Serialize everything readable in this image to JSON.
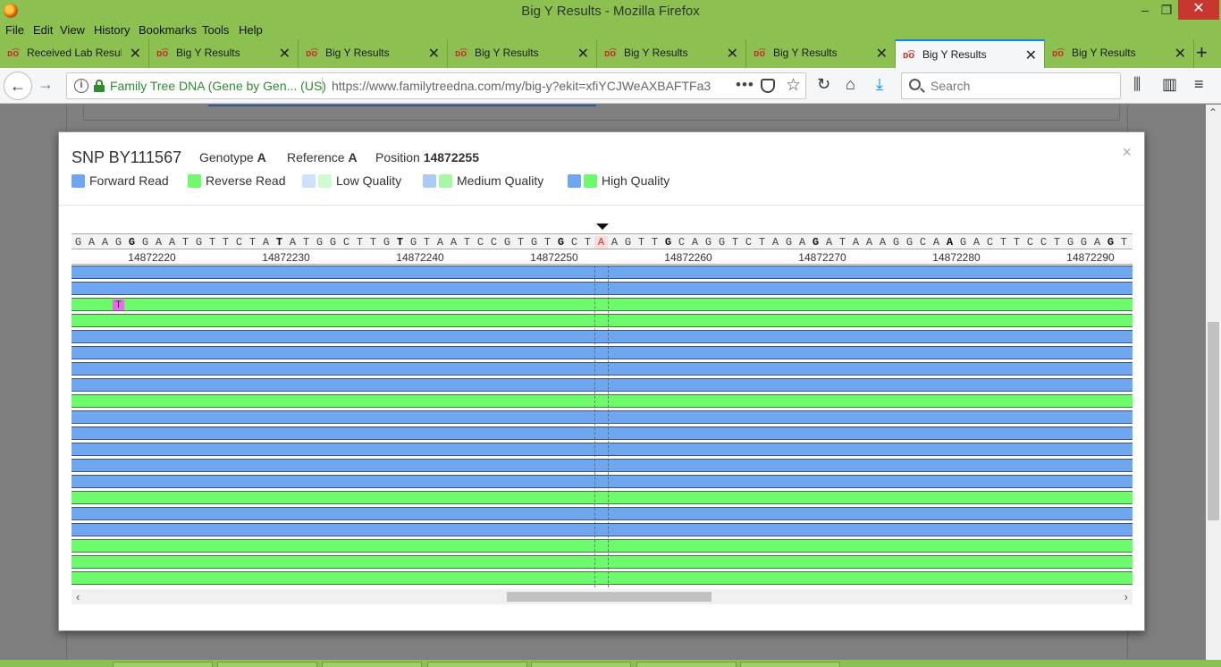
{
  "window": {
    "title": "Big Y Results - Mozilla Firefox",
    "min": "‒",
    "max": "❐",
    "close": "✕"
  },
  "menu": [
    "File",
    "Edit",
    "View",
    "History",
    "Bookmarks",
    "Tools",
    "Help"
  ],
  "tabs": [
    {
      "label": "Received Lab Results"
    },
    {
      "label": "Big Y Results"
    },
    {
      "label": "Big Y Results"
    },
    {
      "label": "Big Y Results"
    },
    {
      "label": "Big Y Results"
    },
    {
      "label": "Big Y Results"
    },
    {
      "label": "Big Y Results",
      "active": true
    },
    {
      "label": "Big Y Results"
    }
  ],
  "favicon_glyph": "ᴅ͡ᴏ",
  "nav": {
    "site_identity": "Family Tree DNA (Gene by Gen...  (US)",
    "url": "https://www.familytreedna.com/my/big-y?ekit=xfiYCJWeAXBAFTFa3",
    "search_placeholder": "Search",
    "page_actions": "•••"
  },
  "modal": {
    "close": "×",
    "snp_title": "SNP BY111567",
    "genotype_label": "Genotype",
    "genotype": "A",
    "reference_label": "Reference",
    "reference": "A",
    "position_label": "Position",
    "position": "14872255",
    "legend": {
      "forward": "Forward Read",
      "reverse": "Reverse Read",
      "low": "Low Quality",
      "medium": "Medium Quality",
      "high": "High Quality"
    },
    "colors": {
      "forward": "#6ea6f0",
      "reverse": "#6dfa6d",
      "low_fwd": "#cfe2fb",
      "low_rev": "#d0fbd0",
      "med_fwd": "#a9cbf6",
      "med_rev": "#a6f7a6",
      "mismatch": "#ee66ee"
    },
    "sequence": "GAAGGGAATGTTCTATATGGCTTGTGTAATCCGTGTGCTAAGTTGCAGGTCTAGAGATAAAGGCAAGACTTCCTGGAGTT",
    "bold_bases": [
      4,
      15,
      24,
      36,
      44,
      55,
      65,
      77
    ],
    "target_index": 39,
    "ticks": [
      "14872220",
      "14872230",
      "14872240",
      "14872250",
      "14872260",
      "14872270",
      "14872280",
      "14872290"
    ],
    "reads": [
      "fwd",
      "fwd",
      "rev",
      "rev",
      "fwd",
      "fwd",
      "fwd",
      "fwd",
      "rev",
      "fwd",
      "fwd",
      "fwd",
      "fwd",
      "fwd",
      "rev",
      "fwd",
      "fwd",
      "rev",
      "rev",
      "rev"
    ],
    "mismatch": {
      "read_index": 2,
      "base": "T"
    }
  }
}
